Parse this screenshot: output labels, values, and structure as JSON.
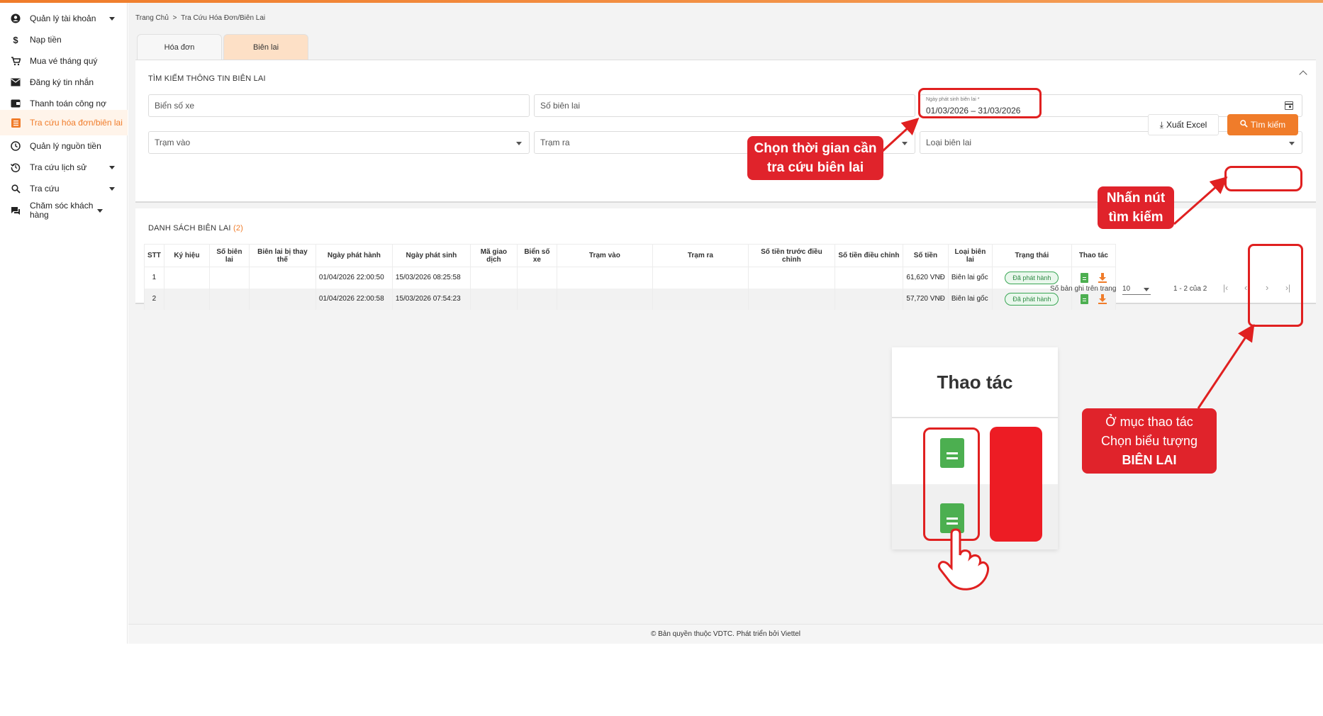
{
  "sidebar": {
    "items": [
      {
        "label": "Quản lý tài khoản",
        "icon": "account-circle-icon",
        "has_caret": true
      },
      {
        "label": "Nạp tiền",
        "icon": "dollar-icon",
        "has_caret": false
      },
      {
        "label": "Mua vé tháng quý",
        "icon": "cart-icon",
        "has_caret": false
      },
      {
        "label": "Đăng ký tin nhắn",
        "icon": "mail-icon",
        "has_caret": false
      },
      {
        "label": "Thanh toán công nợ",
        "icon": "wallet-icon",
        "has_caret": false
      },
      {
        "label": "Tra cứu hóa đơn/biên lai",
        "icon": "receipt-list-icon",
        "has_caret": false,
        "active": true
      },
      {
        "label": "Quản lý nguồn tiền",
        "icon": "clock-money-icon",
        "has_caret": false
      },
      {
        "label": "Tra cứu lịch sử",
        "icon": "history-icon",
        "has_caret": true
      },
      {
        "label": "Tra cứu",
        "icon": "search-icon",
        "has_caret": true
      },
      {
        "label": "Chăm sóc khách hàng",
        "icon": "chat-icon",
        "has_caret": true
      }
    ]
  },
  "breadcrumb": {
    "home": "Trang Chủ",
    "separator": ">",
    "current": "Tra Cứu Hóa Đơn/Biên Lai"
  },
  "tabs": [
    {
      "label": "Hóa đơn",
      "active": false
    },
    {
      "label": "Biên lai",
      "active": true
    }
  ],
  "search": {
    "title": "TÌM KIẾM THÔNG TIN BIÊN LAI",
    "plate_placeholder": "Biển số xe",
    "receipt_no_placeholder": "Số biên lai",
    "date_label": "Ngày phát sinh biên lai *",
    "date_value": "01/03/2026 – 31/03/2026",
    "station_in_placeholder": "Trạm vào",
    "station_out_placeholder": "Trạm ra",
    "receipt_type_placeholder": "Loại biên lai",
    "export_label": "Xuất Excel",
    "search_label": "Tìm kiếm"
  },
  "list": {
    "title": "DANH SÁCH BIÊN LAI",
    "count": "(2)",
    "columns": [
      "STT",
      "Ký hiệu",
      "Số biên lai",
      "Biên lai bị thay thế",
      "Ngày phát hành",
      "Ngày phát sinh",
      "Mã giao dịch",
      "Biển số xe",
      "Trạm vào",
      "Trạm ra",
      "Số tiền trước điều chỉnh",
      "Số tiền điều chỉnh",
      "Số tiền",
      "Loại biên lai",
      "Trạng thái",
      "Thao tác"
    ],
    "rows": [
      {
        "stt": "1",
        "issue_date": "01/04/2026 22:00:50",
        "occur_date": "15/03/2026 08:25:58",
        "amount": "61,620 VNĐ",
        "type": "Biên lai gốc",
        "status": "Đã phát hành"
      },
      {
        "stt": "2",
        "issue_date": "01/04/2026 22:00:58",
        "occur_date": "15/03/2026 07:54:23",
        "amount": "57,720 VNĐ",
        "type": "Biên lai gốc",
        "status": "Đã phát hành"
      }
    ],
    "per_page_label": "Số bản ghi trên trang",
    "per_page_value": "10",
    "range": "1 - 2 của 2"
  },
  "footer": "© Bản quyền thuộc VDTC. Phát triển bởi Viettel",
  "annotations": {
    "callout_date_1": "Chọn thời gian cần",
    "callout_date_2": "tra cứu biên lai",
    "callout_search_1": "Nhấn nút",
    "callout_search_2": "tìm kiếm",
    "callout_action_1": "Ở mục thao tác",
    "callout_action_2": "Chọn biểu tượng",
    "callout_action_3": "BIÊN LAI",
    "zoom_header": "Thao tác"
  },
  "colors": {
    "accent": "#f07c2a",
    "annotation_red": "#e0232b",
    "status_green": "#3aa655"
  }
}
